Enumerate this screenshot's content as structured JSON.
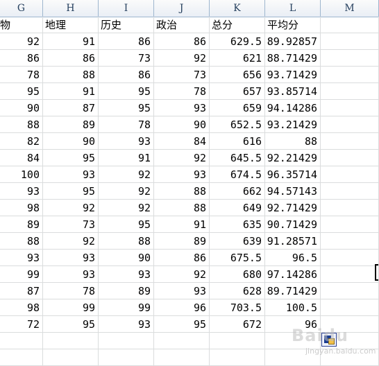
{
  "columns": [
    "G",
    "H",
    "I",
    "J",
    "K",
    "L",
    "M"
  ],
  "subjects": {
    "g": "生物",
    "h": "地理",
    "i": "历史",
    "j": "政治",
    "k": "总分",
    "l": "平均分"
  },
  "rows": [
    {
      "g": "92",
      "h": "91",
      "i": "86",
      "j": "86",
      "k": "629.5",
      "l": "89.92857"
    },
    {
      "g": "86",
      "h": "86",
      "i": "73",
      "j": "92",
      "k": "621",
      "l": "88.71429"
    },
    {
      "g": "78",
      "h": "88",
      "i": "86",
      "j": "73",
      "k": "656",
      "l": "93.71429"
    },
    {
      "g": "95",
      "h": "91",
      "i": "95",
      "j": "78",
      "k": "657",
      "l": "93.85714"
    },
    {
      "g": "90",
      "h": "87",
      "i": "95",
      "j": "93",
      "k": "659",
      "l": "94.14286"
    },
    {
      "g": "88",
      "h": "89",
      "i": "78",
      "j": "90",
      "k": "652.5",
      "l": "93.21429"
    },
    {
      "g": "82",
      "h": "90",
      "i": "93",
      "j": "84",
      "k": "616",
      "l": "88"
    },
    {
      "g": "84",
      "h": "95",
      "i": "91",
      "j": "92",
      "k": "645.5",
      "l": "92.21429"
    },
    {
      "g": "100",
      "h": "93",
      "i": "92",
      "j": "93",
      "k": "674.5",
      "l": "96.35714"
    },
    {
      "g": "93",
      "h": "95",
      "i": "92",
      "j": "88",
      "k": "662",
      "l": "94.57143"
    },
    {
      "g": "98",
      "h": "92",
      "i": "92",
      "j": "88",
      "k": "649",
      "l": "92.71429"
    },
    {
      "g": "89",
      "h": "73",
      "i": "95",
      "j": "91",
      "k": "635",
      "l": "90.71429"
    },
    {
      "g": "88",
      "h": "92",
      "i": "88",
      "j": "89",
      "k": "639",
      "l": "91.28571"
    },
    {
      "g": "93",
      "h": "93",
      "i": "90",
      "j": "86",
      "k": "675.5",
      "l": "96.5"
    },
    {
      "g": "99",
      "h": "93",
      "i": "93",
      "j": "92",
      "k": "680",
      "l": "97.14286"
    },
    {
      "g": "87",
      "h": "78",
      "i": "89",
      "j": "93",
      "k": "628",
      "l": "89.71429"
    },
    {
      "g": "98",
      "h": "99",
      "i": "99",
      "j": "96",
      "k": "703.5",
      "l": "100.5"
    },
    {
      "g": "72",
      "h": "95",
      "i": "93",
      "j": "95",
      "k": "672",
      "l": "96"
    }
  ],
  "paste_options_icon": "paste-options-icon",
  "watermark": {
    "main": "Baidu",
    "sub": "jingyan.baidu.com"
  }
}
